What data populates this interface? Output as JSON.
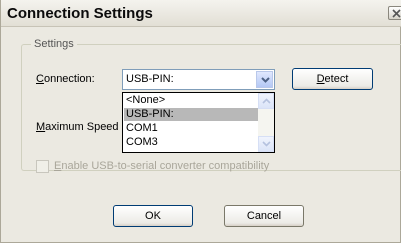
{
  "window": {
    "title": "Connection Settings"
  },
  "settings_group": {
    "legend": "Settings"
  },
  "connection": {
    "label_hotkey": "C",
    "label_rest": "onnection:",
    "selected_value": "USB-PIN:",
    "options": [
      "<None>",
      "USB-PIN:",
      "COM1",
      "COM3"
    ],
    "highlighted_index": 1
  },
  "detect_button": {
    "label_hotkey": "D",
    "label_rest": "etect"
  },
  "max_speed": {
    "label_hotkey": "M",
    "label_rest": "aximum Speed"
  },
  "usb_serial_checkbox": {
    "label_hotkey": "E",
    "label_rest": "nable USB-to-serial converter compatibility",
    "checked": false,
    "enabled": false
  },
  "ok_button": {
    "label": "OK"
  },
  "cancel_button": {
    "label": "Cancel"
  },
  "colors": {
    "highlight": "#b8b8b8",
    "dialog_bg": "#ebe9e1",
    "button_border": "#003c74"
  }
}
